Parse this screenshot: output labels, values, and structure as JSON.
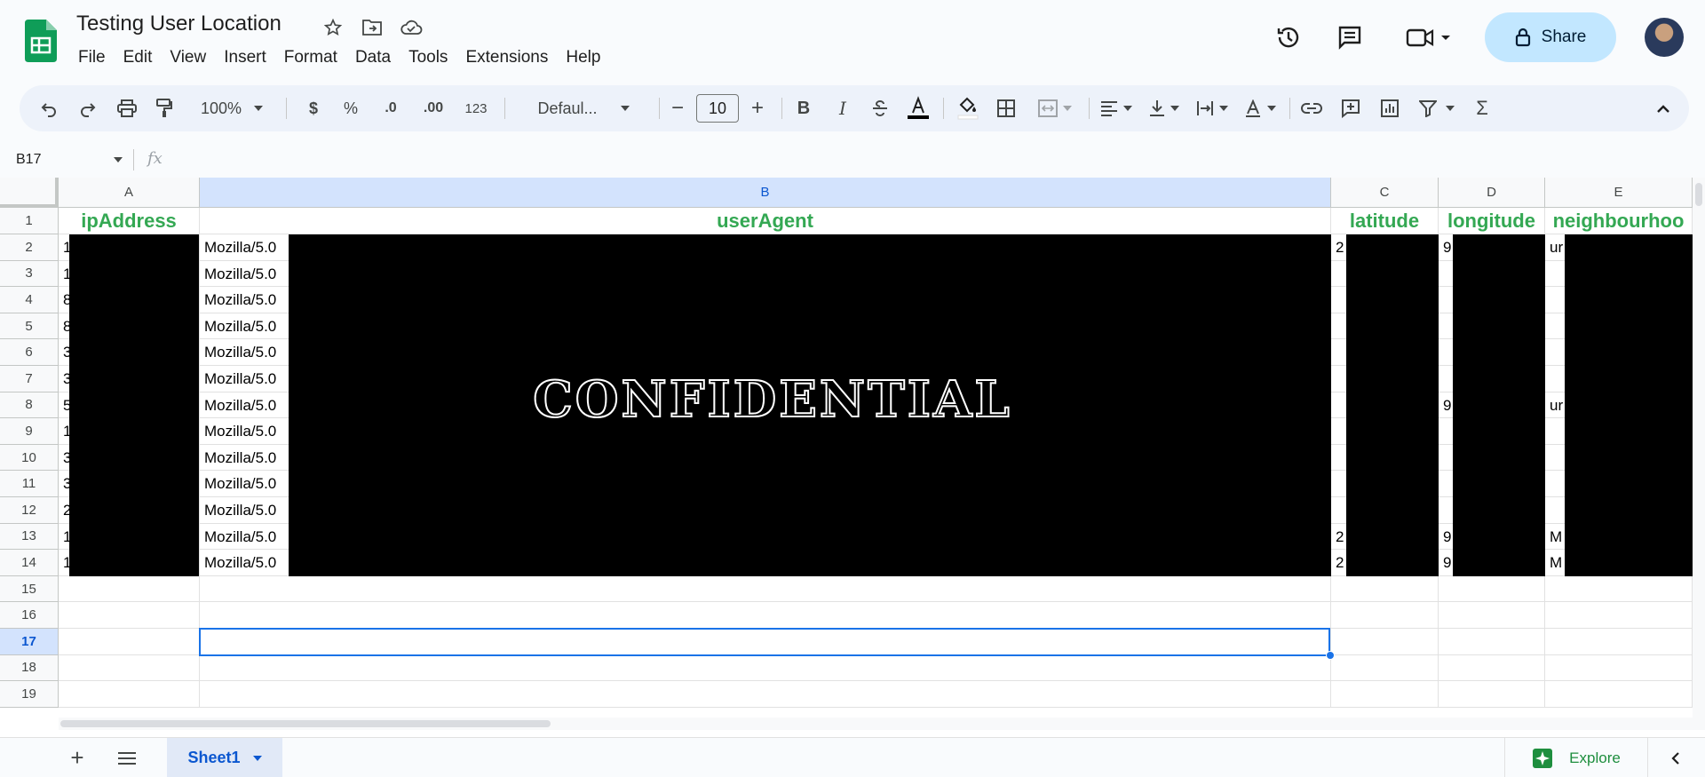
{
  "doc": {
    "title": "Testing User Location"
  },
  "menu": [
    "File",
    "Edit",
    "View",
    "Insert",
    "Format",
    "Data",
    "Tools",
    "Extensions",
    "Help"
  ],
  "header": {
    "share_label": "Share"
  },
  "toolbar": {
    "zoom": "100%",
    "currency": "$",
    "percent": "%",
    "dec_decrease": ".0",
    "dec_increase": ".00",
    "number_format": "123",
    "font": "Defaul...",
    "font_size": "10",
    "minus": "−",
    "plus": "+",
    "bold": "B",
    "italic": "I",
    "sum": "Σ"
  },
  "formula_bar": {
    "cell_ref": "B17",
    "fx": "fx"
  },
  "columns": [
    "A",
    "B",
    "C",
    "D",
    "E"
  ],
  "rows": [
    "1",
    "2",
    "3",
    "4",
    "5",
    "6",
    "7",
    "8",
    "9",
    "10",
    "11",
    "12",
    "13",
    "14",
    "15",
    "16",
    "17",
    "18",
    "19"
  ],
  "sheet_headers": {
    "a": "ipAddress",
    "b": "userAgent",
    "c": "latitude",
    "d": "longitude",
    "e": "neighbourhoo"
  },
  "col_a_values": [
    "1",
    "1",
    "8",
    "8",
    "3",
    "3",
    "5",
    "1",
    "3",
    "3",
    "2",
    "1",
    "1"
  ],
  "col_b_value": "Mozilla/5.0",
  "col_c_values": {
    "r2": "2",
    "r13": "2",
    "r14": "2"
  },
  "col_d_values": {
    "r2": "9",
    "r8": "9",
    "r13": "9",
    "r14": "9"
  },
  "col_e_values": {
    "r2": "ur",
    "r8": "ur",
    "r13": "M",
    "r14": "M"
  },
  "redaction_label": "CONFIDENTIAL",
  "bottom": {
    "sheet_name": "Sheet1",
    "explore_label": "Explore"
  },
  "colors": {
    "accent": "#0b57d0",
    "header_green": "#34a853",
    "share_bg": "#c2e7ff"
  }
}
